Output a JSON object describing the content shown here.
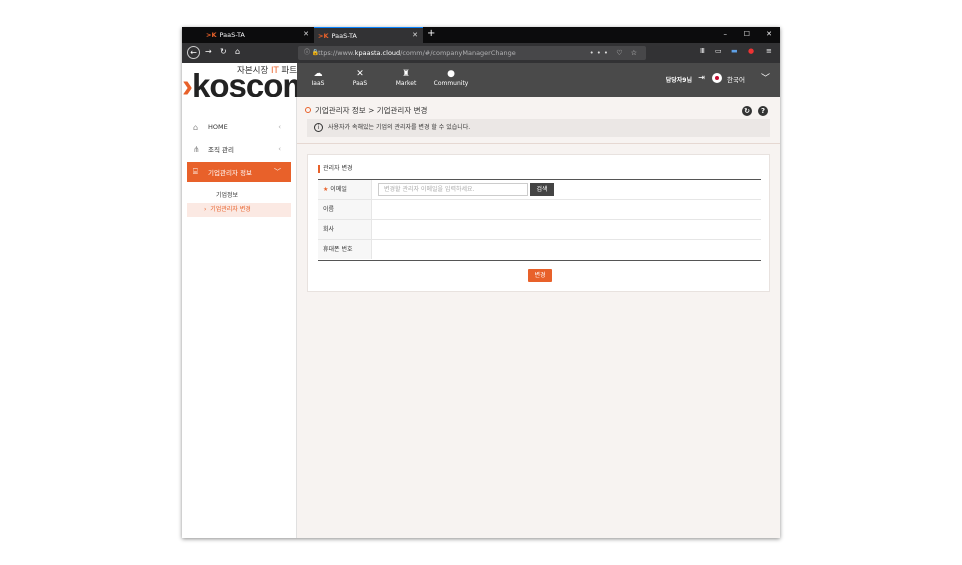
{
  "browser": {
    "tabs": [
      {
        "title": "PaaS-TA",
        "favicon": ">K"
      },
      {
        "title": "PaaS-TA",
        "favicon": ">K"
      }
    ],
    "new_tab": "+",
    "window_controls": {
      "minimize": "–",
      "maximize": "☐",
      "close": "✕"
    },
    "url_prefix": "https://www.",
    "url_domain": "kpaasta.cloud",
    "url_path": "/comm/#/companyManagerChange",
    "url_actions": "••• ♡ ☆"
  },
  "header": {
    "logo_sub_prefix": "자본시장 ",
    "logo_sub_it": "IT",
    "logo_sub_suffix": " 파트너",
    "logo_arrow": "›",
    "logo_text": "koscom",
    "menu": [
      {
        "label": "IaaS",
        "icon": "cloud-icon"
      },
      {
        "label": "PaaS",
        "icon": "tools-icon"
      },
      {
        "label": "Market",
        "icon": "basket-icon"
      },
      {
        "label": "Community",
        "icon": "chat-icon"
      }
    ],
    "user": "담당자9님",
    "language": "한국어"
  },
  "sidebar": {
    "items": [
      {
        "label": "HOME",
        "icon": "home-icon"
      },
      {
        "label": "조직 관리",
        "icon": "org-icon"
      },
      {
        "label": "기업관리자 정보",
        "icon": "company-icon"
      }
    ],
    "sub_items": [
      {
        "label": "기업정보"
      },
      {
        "label": "기업관리자 변경"
      }
    ]
  },
  "main": {
    "breadcrumb": "기업관리자 정보 > 기업관리자 변경",
    "notice": "사용자가 속해있는 기업의 관리자를 변경 할 수 있습니다.",
    "section_title": "관리자 변경",
    "fields": [
      {
        "label": "이메일",
        "required": "★ ",
        "placeholder": "변경할 관리자 이메일을 입력하세요.",
        "button": "검색"
      },
      {
        "label": "이름"
      },
      {
        "label": "회사"
      },
      {
        "label": "휴대폰 번호"
      }
    ],
    "submit": "변경"
  },
  "colors": {
    "accent": "#e8612a",
    "topbar": "#4a4a4a",
    "browser_dark": "#0c0c0d"
  }
}
